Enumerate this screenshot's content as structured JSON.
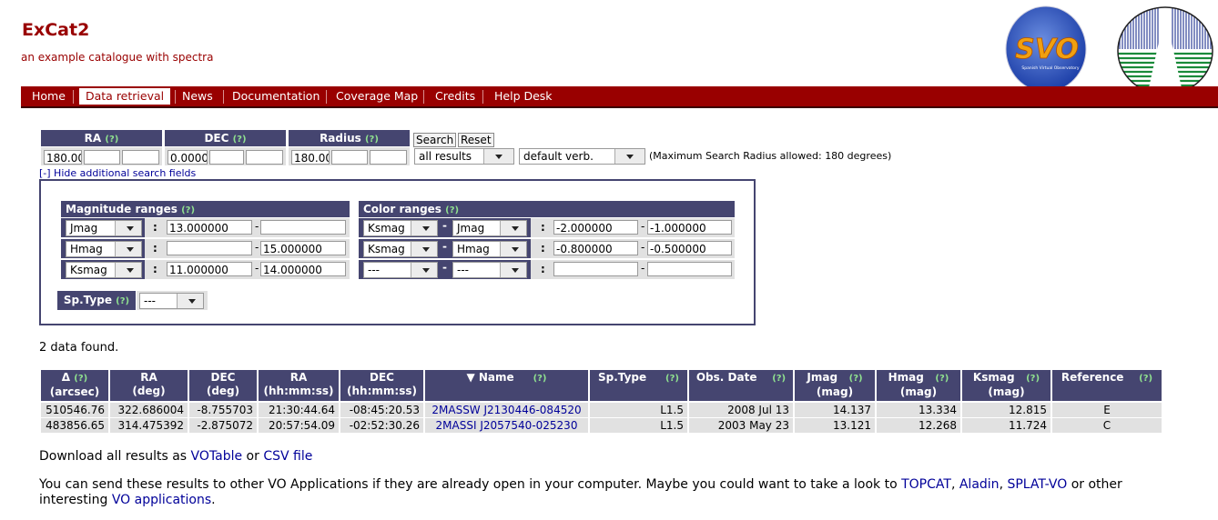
{
  "site": {
    "title": "ExCat2",
    "subtitle": "an example catalogue with spectra"
  },
  "logos": {
    "svo_text": "SVO",
    "svo_caption": "Spanish Virtual Observatory"
  },
  "nav": [
    {
      "label": "Home",
      "active": false
    },
    {
      "label": "Data retrieval",
      "active": true
    },
    {
      "label": "News",
      "active": false
    },
    {
      "label": "Documentation",
      "active": false
    },
    {
      "label": "Coverage Map",
      "active": false
    },
    {
      "label": "Credits",
      "active": false
    },
    {
      "label": "Help Desk",
      "active": false
    }
  ],
  "search": {
    "ra_label": "RA",
    "dec_label": "DEC",
    "radius_label": "Radius",
    "help": "(?)",
    "ra": [
      "180.00",
      "",
      ""
    ],
    "dec": [
      "0.0000",
      "",
      ""
    ],
    "radius": [
      "180.00",
      "",
      ""
    ],
    "search_button": "Search",
    "reset_button": "Reset",
    "results_select": "all results",
    "verb_select": "default verb.",
    "max_radius_note": "(Maximum Search Radius allowed: 180 degrees)",
    "toggle_link": "[-] Hide additional search fields"
  },
  "advanced": {
    "mag_title": "Magnitude ranges",
    "color_title": "Color ranges",
    "help": "(?)",
    "sep_colon": ":",
    "sep_dash": "-",
    "mag_rows": [
      {
        "band": "Jmag",
        "min": "13.000000",
        "max": ""
      },
      {
        "band": "Hmag",
        "min": "",
        "max": "15.000000"
      },
      {
        "band": "Ksmag",
        "min": "11.000000",
        "max": "14.000000"
      }
    ],
    "color_rows": [
      {
        "a": "Ksmag",
        "b": "Jmag",
        "min": "-2.000000",
        "max": "-1.000000"
      },
      {
        "a": "Ksmag",
        "b": "Hmag",
        "min": "-0.800000",
        "max": "-0.500000"
      },
      {
        "a": "---",
        "b": "---",
        "min": "",
        "max": ""
      }
    ],
    "sptype_label": "Sp.Type",
    "sptype_value": "---"
  },
  "results": {
    "count_text": "2 data found.",
    "headers": [
      {
        "l1": "Δ",
        "l2": "(arcsec)",
        "q": "(?)"
      },
      {
        "l1": "RA",
        "l2": "(deg)"
      },
      {
        "l1": "DEC",
        "l2": "(deg)"
      },
      {
        "l1": "RA",
        "l2": "(hh:mm:ss)"
      },
      {
        "l1": "DEC",
        "l2": "(hh:mm:ss)"
      },
      {
        "l1": "▼ Name",
        "l2": "",
        "q": "(?)"
      },
      {
        "l1": "Sp.Type",
        "l2": "",
        "q": "(?)"
      },
      {
        "l1": "Obs. Date",
        "l2": "",
        "q": "(?)"
      },
      {
        "l1": "Jmag",
        "l2": "(mag)",
        "q": "(?)"
      },
      {
        "l1": "Hmag",
        "l2": "(mag)",
        "q": "(?)"
      },
      {
        "l1": "Ksmag",
        "l2": "(mag)",
        "q": "(?)"
      },
      {
        "l1": "Reference",
        "l2": "",
        "q": "(?)"
      }
    ],
    "rows": [
      [
        "510546.76",
        "322.686004",
        "-8.755703",
        "21:30:44.64",
        "-08:45:20.53",
        "2MASSW J2130446-084520",
        "L1.5",
        "2008 Jul 13",
        "14.137",
        "13.334",
        "12.815",
        "E"
      ],
      [
        "483856.65",
        "314.475392",
        "-2.875072",
        "20:57:54.09",
        "-02:52:30.26",
        "2MASSI J2057540-025230",
        "L1.5",
        "2003 May 23",
        "13.121",
        "12.268",
        "11.724",
        "C"
      ]
    ]
  },
  "download": {
    "prefix": "Download all results as ",
    "votable": "VOTable",
    "or": " or ",
    "csv": "CSV file"
  },
  "vo": {
    "text1": "You can send these results to other VO Applications if they are already open in your computer. Maybe you could want to take a look to ",
    "topcat": "TOPCAT",
    "comma1": ", ",
    "aladin": "Aladin",
    "comma2": ", ",
    "splat": "SPLAT-VO",
    "text2": " or other",
    "text3": "interesting ",
    "vo_apps": "VO applications",
    "text4": "."
  }
}
